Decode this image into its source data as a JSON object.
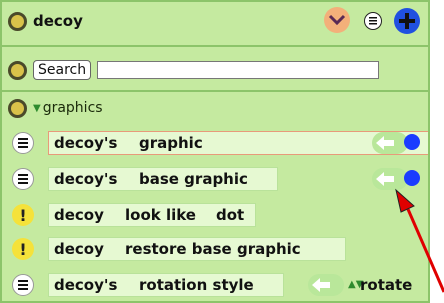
{
  "header": {
    "title": "decoy"
  },
  "search": {
    "label": "Search",
    "value": ""
  },
  "category": {
    "label": "graphics"
  },
  "blocks": [
    {
      "words": [
        "decoy's",
        "graphic"
      ],
      "icon": "menu-icon"
    },
    {
      "words": [
        "decoy's",
        "base graphic"
      ],
      "icon": "menu-icon"
    },
    {
      "words": [
        "decoy",
        "look like",
        "dot"
      ],
      "icon": "exclamation-icon"
    },
    {
      "words": [
        "decoy",
        "restore base graphic"
      ],
      "icon": "exclamation-icon"
    },
    {
      "words": [
        "decoy's",
        "rotation style"
      ],
      "icon": "menu-icon",
      "value": "rotate"
    }
  ],
  "colors": {
    "panel": "#c5eaa0",
    "accent": "#1a3cff",
    "arrow": "#e00000"
  }
}
